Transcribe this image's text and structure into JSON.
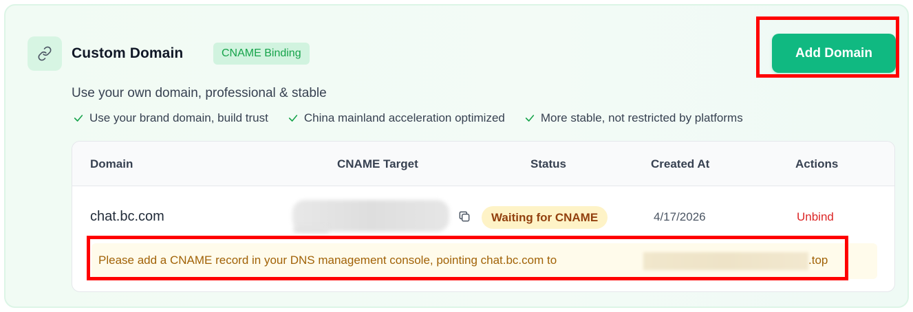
{
  "header": {
    "title": "Custom Domain",
    "badge": "CNAME Binding",
    "add_button": "Add Domain",
    "chain_icon": "link-icon"
  },
  "subtitle": "Use your own domain, professional & stable",
  "features": [
    "Use your brand domain, build trust",
    "China mainland acceleration optimized",
    "More stable, not restricted by platforms"
  ],
  "table": {
    "columns": [
      "Domain",
      "CNAME Target",
      "Status",
      "Created At",
      "Actions"
    ],
    "rows": [
      {
        "domain": "chat.bc.com",
        "cname_target": "",
        "status": "Waiting for CNAME",
        "created_at": "4/17/2026",
        "action": "Unbind",
        "notice_prefix": "Please add a CNAME record in your DNS management console, pointing chat.bc.com to",
        "notice_suffix": ".top"
      }
    ]
  },
  "colors": {
    "accent": "#10b981",
    "badge_text": "#16a34a",
    "status_bg": "#fef3c7",
    "danger": "#dc2626",
    "highlight": "#ff0000"
  }
}
